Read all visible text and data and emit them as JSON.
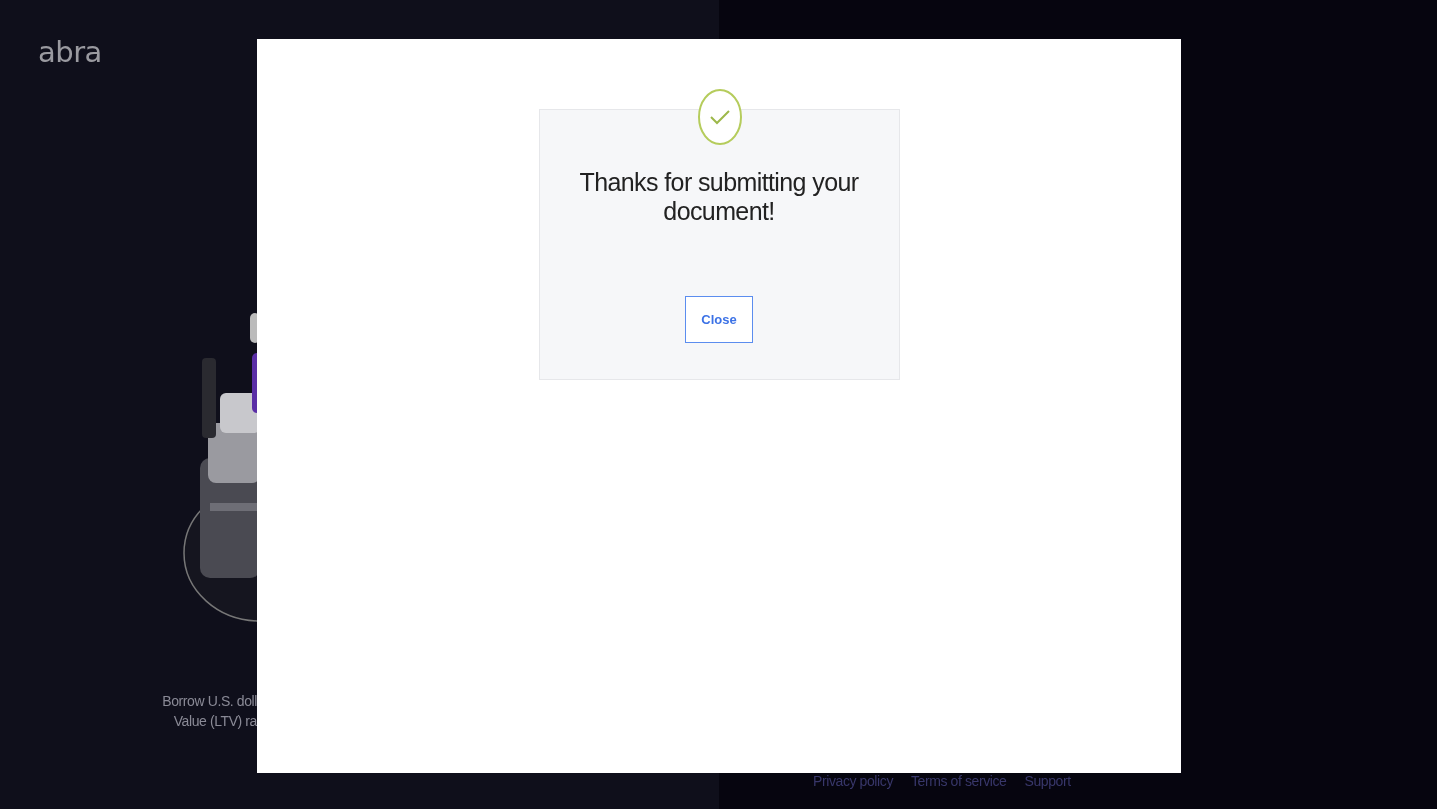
{
  "logo": "abra",
  "hero": {
    "kind": "picture",
    "caption_lines": [
      "Borrow U.S. doll",
      "Value (LTV) ra"
    ]
  },
  "footer_links": [
    "Privacy policy",
    "Terms of service",
    "Support"
  ],
  "modal": {
    "title": "Thanks for submitting your document!",
    "success": true,
    "button": "Close"
  }
}
